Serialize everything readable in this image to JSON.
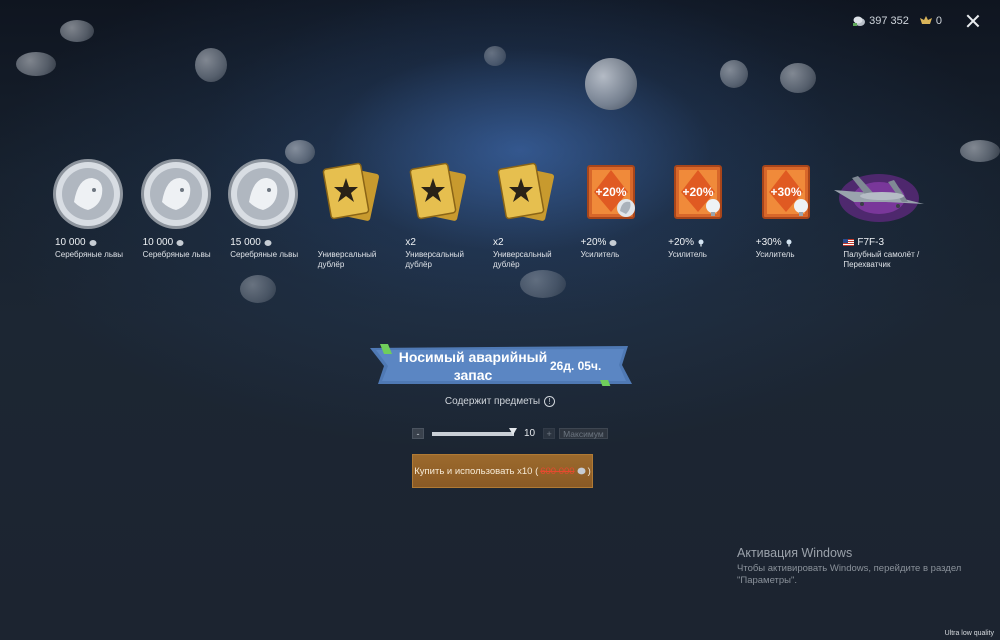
{
  "topbar": {
    "silver_lions": "397 352",
    "golden_eagles": "0"
  },
  "rewards": [
    {
      "amount": "10 000",
      "name": "Серебряные львы",
      "icon": "silver-lion-coin-icon"
    },
    {
      "amount": "10 000",
      "name": "Серебряные львы",
      "icon": "silver-lion-coin-icon"
    },
    {
      "amount": "15 000",
      "name": "Серебряные львы",
      "icon": "silver-lion-coin-icon"
    },
    {
      "amount": "",
      "name": "Универсальный дублёр",
      "icon": "universal-backup-icon"
    },
    {
      "amount": "x2",
      "name": "Универсальный дублёр",
      "icon": "universal-backup-icon"
    },
    {
      "amount": "x2",
      "name": "Универсальный дублёр",
      "icon": "universal-backup-icon"
    },
    {
      "amount": "+20%",
      "name": "Усилитель",
      "icon": "booster-icon",
      "badge": "+20%"
    },
    {
      "amount": "+20%",
      "name": "Усилитель",
      "icon": "booster-icon",
      "badge": "+20%"
    },
    {
      "amount": "+30%",
      "name": "Усилитель",
      "icon": "booster-icon",
      "badge": "+30%"
    },
    {
      "amount": "F7F-3",
      "name": "Палубный самолёт / Перехватчик",
      "icon": "aircraft-icon"
    }
  ],
  "banner": {
    "title": "Носимый аварийный запас",
    "time_left": "26д. 05ч."
  },
  "contains_label": "Содержит предметы",
  "slider": {
    "minus": "-",
    "plus": "+",
    "quantity": "10",
    "max_label": "Максимум"
  },
  "buy": {
    "label": "Купить и использовать x10 (",
    "price": "600 000",
    "closing": ")"
  },
  "watermark": {
    "title": "Активация Windows",
    "text": "Чтобы активировать Windows, перейдите в раздел \"Параметры\"."
  },
  "quality_label": "Ultra low quality",
  "colors": {
    "accent_blue": "#4f79b4",
    "buy_button": "#9c6a2d",
    "price_red": "#e64a2f",
    "booster_orange": "#d8672a"
  }
}
